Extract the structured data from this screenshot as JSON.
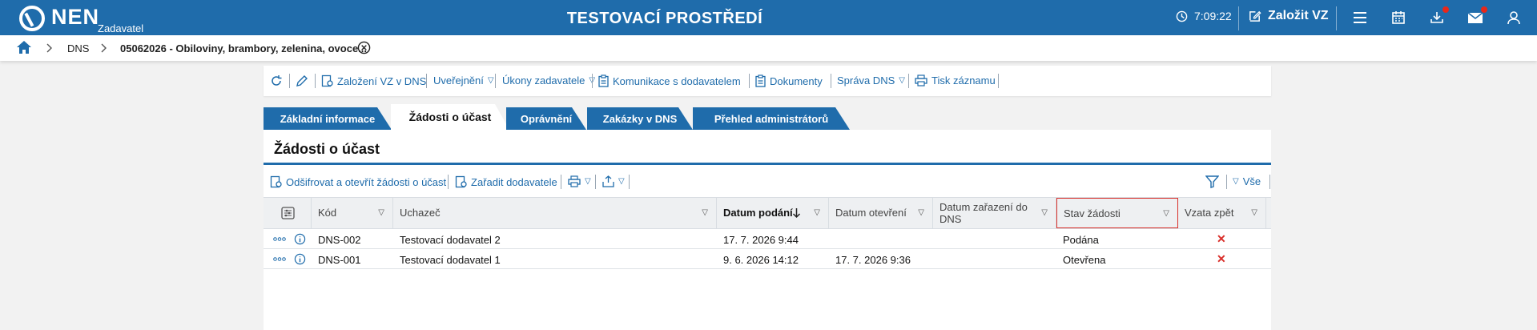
{
  "header": {
    "logo": "NEN",
    "role": "Zadavatel",
    "env_title": "TESTOVACÍ PROSTŘEDÍ",
    "time": "7:09:22",
    "new_vz": "Založit VZ"
  },
  "breadcrumb": {
    "items": [
      "DNS",
      "05062026 - Obiloviny, brambory, zelenina, ovoce..."
    ]
  },
  "toolbar": {
    "items": [
      "Založení VZ v DNS",
      "Uveřejnění",
      "Úkony zadavatele",
      "Komunikace s dodavatelem",
      "Dokumenty",
      "Správa DNS",
      "Tisk záznamu"
    ]
  },
  "tabs": [
    {
      "label": "Základní informace",
      "active": false
    },
    {
      "label": "Žádosti o účast",
      "active": true
    },
    {
      "label": "Oprávnění",
      "active": false
    },
    {
      "label": "Zakázky v DNS",
      "active": false
    },
    {
      "label": "Přehled administrátorů",
      "active": false
    }
  ],
  "section": {
    "title": "Žádosti o účast",
    "decrypt_label": "Odšifrovat a otevřít žádosti o účast",
    "assign_label": "Zařadit dodavatele",
    "all_label": "Vše"
  },
  "table": {
    "columns": [
      "Kód",
      "Uchazeč",
      "Datum podání",
      "Datum otevření",
      "Datum zařazení do DNS",
      "Stav žádosti",
      "Vzata zpět"
    ],
    "rows": [
      {
        "kod": "DNS-002",
        "uchazec": "Testovací dodavatel 2",
        "podani": "17. 7. 2026 9:44",
        "otevreni": "",
        "zarazeni": "",
        "stav": "Podána",
        "vzata": "✕"
      },
      {
        "kod": "DNS-001",
        "uchazec": "Testovací dodavatel 1",
        "podani": "9. 6. 2026 14:12",
        "otevreni": "17. 7. 2026 9:36",
        "zarazeni": "",
        "stav": "Otevřena",
        "vzata": "✕"
      }
    ]
  }
}
